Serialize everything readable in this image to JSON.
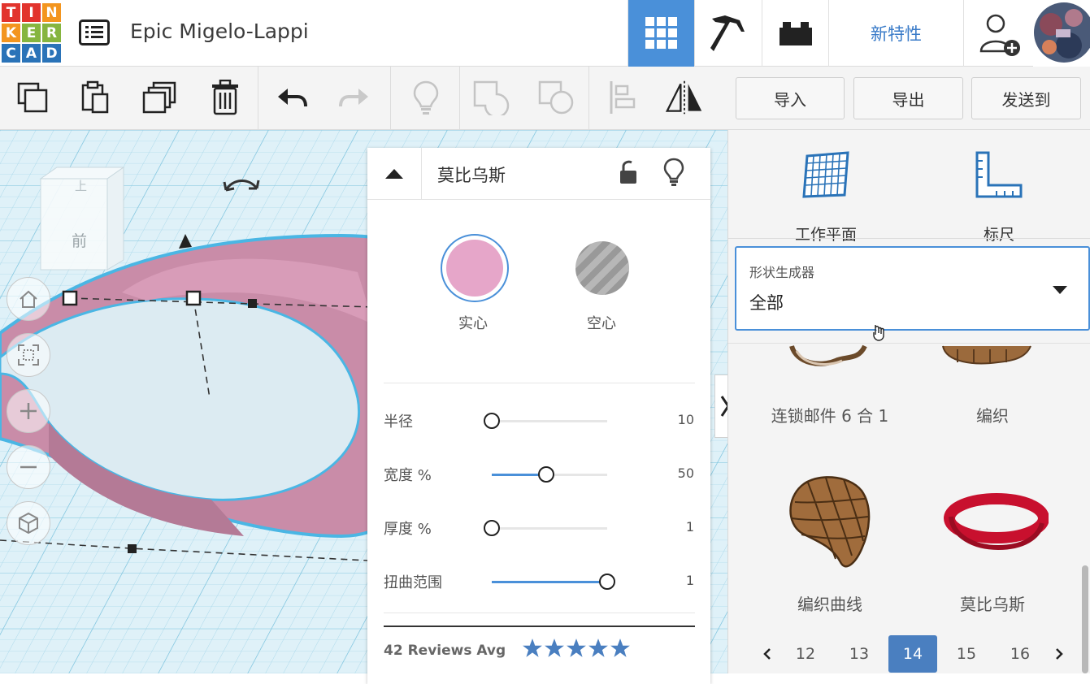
{
  "logo": {
    "letters": [
      "T",
      "I",
      "N",
      "K",
      "E",
      "R",
      "C",
      "A",
      "D"
    ],
    "colors": [
      "#e2342d",
      "#e2342d",
      "#f3951f",
      "#f3951f",
      "#86b53f",
      "#86b53f",
      "#2a73b8",
      "#2a73b8",
      "#2a73b8"
    ]
  },
  "header": {
    "title": "Epic Migelo-Lappi",
    "new_features": "新特性"
  },
  "toolbar": {
    "import_label": "导入",
    "export_label": "导出",
    "send_label": "发送到"
  },
  "viewcube": {
    "top": "上",
    "front": "前"
  },
  "inspector": {
    "title": "莫比乌斯",
    "solid_label": "实心",
    "hole_label": "空心",
    "solid_color": "#e6a6c9",
    "params": [
      {
        "label": "半径",
        "value": "10",
        "fraction": 0.0
      },
      {
        "label": "宽度 %",
        "value": "50",
        "fraction": 0.47
      },
      {
        "label": "厚度 %",
        "value": "1",
        "fraction": 0.0
      },
      {
        "label": "扭曲范围",
        "value": "1",
        "fraction": 1.0
      }
    ],
    "reviews": "42 Reviews Avg",
    "stars": 5
  },
  "rightpanel": {
    "workplane_label": "工作平面",
    "ruler_label": "标尺",
    "dropdown_caption": "形状生成器",
    "dropdown_value": "全部",
    "shapes": [
      {
        "label": "连锁邮件 6 合 1"
      },
      {
        "label": "编织"
      },
      {
        "label": "编织曲线"
      },
      {
        "label": "莫比乌斯"
      }
    ],
    "pages": [
      "12",
      "13",
      "14",
      "15",
      "16"
    ],
    "active_page": "14"
  },
  "colors": {
    "accent": "#4a90d9",
    "shape_pink": "#c98ca8",
    "shape_outline": "#4ab6e4"
  }
}
